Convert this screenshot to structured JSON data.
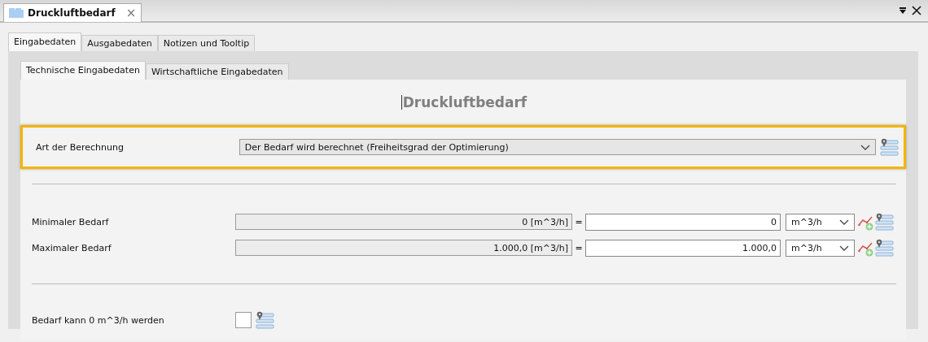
{
  "document_tab": {
    "title": "Druckluftbedarf",
    "close": "×"
  },
  "tabs": [
    {
      "label": "Eingabedaten",
      "selected": true
    },
    {
      "label": "Ausgabedaten",
      "selected": false
    },
    {
      "label": "Notizen und Tooltip",
      "selected": false
    }
  ],
  "sub_tabs": [
    {
      "label": "Technische Eingabedaten",
      "selected": true
    },
    {
      "label": "Wirtschaftliche Eingabedaten",
      "selected": false
    }
  ],
  "heading": "Druckluftbedarf",
  "calculation": {
    "label": "Art der Berechnung",
    "value": "Der Bedarf wird berechnet (Freiheitsgrad der Optimierung)",
    "highlighted": true
  },
  "quantities": [
    {
      "label": "Minimaler Bedarf",
      "computed": "0 [m^3/h]",
      "equals": "=",
      "value": "0",
      "unit": "m^3/h"
    },
    {
      "label": "Maximaler Bedarf",
      "computed": "1.000,0 [m^3/h]",
      "equals": "=",
      "value": "1.000,0",
      "unit": "m^3/h"
    }
  ],
  "zero_allowed": {
    "label": "Bedarf kann 0 m^3/h werden",
    "checked": false
  }
}
